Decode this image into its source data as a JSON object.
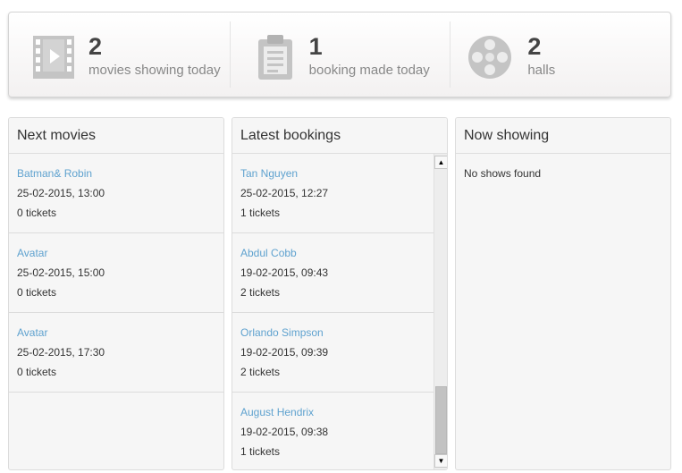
{
  "stats": [
    {
      "icon": "film-icon",
      "value": "2",
      "label": "movies showing today"
    },
    {
      "icon": "clipboard-icon",
      "value": "1",
      "label": "booking made today"
    },
    {
      "icon": "film-reel-icon",
      "value": "2",
      "label": "halls"
    }
  ],
  "panels": {
    "next_movies": {
      "title": "Next movies",
      "items": [
        {
          "name": "Batman& Robin",
          "datetime": "25-02-2015, 13:00",
          "tickets": "0 tickets"
        },
        {
          "name": "Avatar",
          "datetime": "25-02-2015, 15:00",
          "tickets": "0 tickets"
        },
        {
          "name": "Avatar",
          "datetime": "25-02-2015, 17:30",
          "tickets": "0 tickets"
        }
      ]
    },
    "latest_bookings": {
      "title": "Latest bookings",
      "items": [
        {
          "name": "Tan Nguyen",
          "datetime": "25-02-2015, 12:27",
          "tickets": "1 tickets"
        },
        {
          "name": "Abdul Cobb",
          "datetime": "19-02-2015, 09:43",
          "tickets": "2 tickets"
        },
        {
          "name": "Orlando Simpson",
          "datetime": "19-02-2015, 09:39",
          "tickets": "2 tickets"
        },
        {
          "name": "August Hendrix",
          "datetime": "19-02-2015, 09:38",
          "tickets": "1 tickets"
        }
      ]
    },
    "now_showing": {
      "title": "Now showing",
      "empty_text": "No shows found"
    }
  },
  "colors": {
    "link": "#5fa2cf",
    "icon": "#c4c4c4"
  }
}
